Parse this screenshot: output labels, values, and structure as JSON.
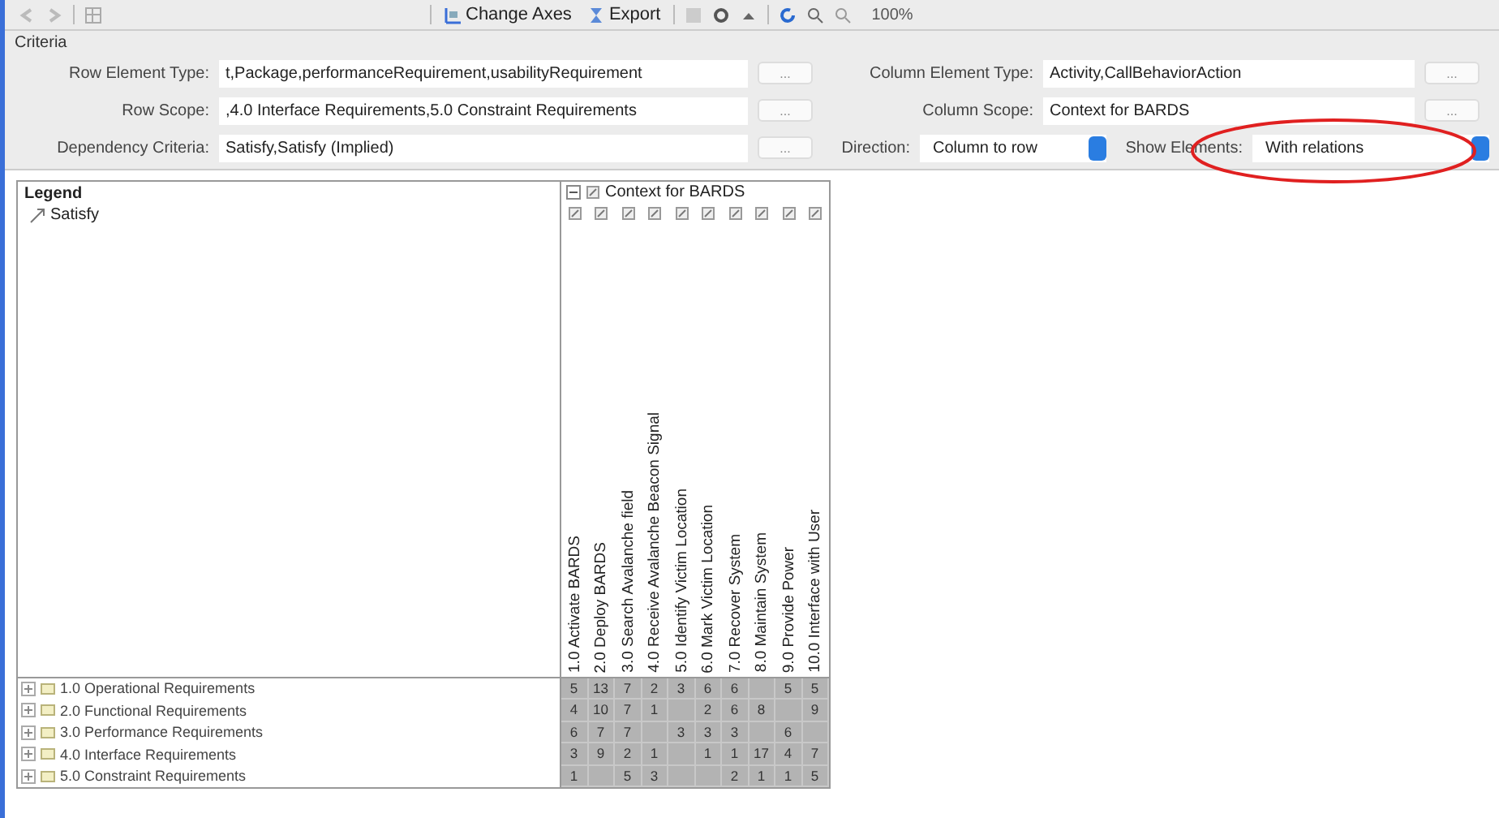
{
  "toolbar": {
    "buttons": [
      {
        "label": "Change Axes",
        "kind": "axes"
      },
      {
        "label": "Export",
        "kind": "export"
      }
    ],
    "zoom": "100%"
  },
  "criteria": {
    "title": "Criteria",
    "rows": [
      {
        "left": {
          "label": "Row Element Type:",
          "value": "t,Package,performanceRequirement,usabilityRequirement",
          "button": "..."
        },
        "right": [
          {
            "kind": "text",
            "label": "Column Element Type:",
            "value": "Activity,CallBehaviorAction",
            "button": "..."
          }
        ]
      },
      {
        "left": {
          "label": "Row Scope:",
          "value": ",4.0 Interface Requirements,5.0 Constraint Requirements",
          "button": "..."
        },
        "right": [
          {
            "kind": "text",
            "label": "Column Scope:",
            "value": "Context for BARDS",
            "button": "..."
          }
        ]
      },
      {
        "left": {
          "label": "Dependency Criteria:",
          "value": "Satisfy,Satisfy (Implied)",
          "button": "..."
        },
        "right": [
          {
            "kind": "select",
            "label": "Direction:",
            "value": "Column to row",
            "circled": false
          },
          {
            "kind": "select",
            "label": "Show Elements:",
            "value": "With relations",
            "circled": true
          }
        ]
      }
    ]
  },
  "legend": {
    "title": "Legend",
    "items": [
      {
        "label": "Satisfy"
      }
    ]
  },
  "matrix": {
    "context": "Context for BARDS",
    "columns": [
      "1.0 Activate BARDS",
      "2.0 Deploy BARDS",
      "3.0 Search Avalanche field",
      "4.0 Receive Avalanche Beacon Signal",
      "5.0 Identify Victim Location",
      "6.0 Mark Victim Location",
      "7.0 Recover System",
      "8.0 Maintain System",
      "9.0 Provide Power",
      "10.0 Interface with User"
    ],
    "rows": [
      {
        "label": "1.0 Operational Requirements",
        "cells": [
          "5",
          "13",
          "7",
          "2",
          "3",
          "6",
          "6",
          "",
          "5",
          "5"
        ]
      },
      {
        "label": "2.0 Functional Requirements",
        "cells": [
          "4",
          "10",
          "7",
          "1",
          "",
          "2",
          "6",
          "8",
          "",
          "9"
        ]
      },
      {
        "label": "3.0 Performance Requirements",
        "cells": [
          "6",
          "7",
          "7",
          "",
          "3",
          "3",
          "3",
          "",
          "6",
          ""
        ]
      },
      {
        "label": "4.0 Interface Requirements",
        "cells": [
          "3",
          "9",
          "2",
          "1",
          "",
          "1",
          "1",
          "17",
          "4",
          "7"
        ]
      },
      {
        "label": "5.0 Constraint Requirements",
        "cells": [
          "1",
          "",
          "5",
          "3",
          "",
          "",
          "2",
          "1",
          "1",
          "5"
        ]
      }
    ]
  }
}
